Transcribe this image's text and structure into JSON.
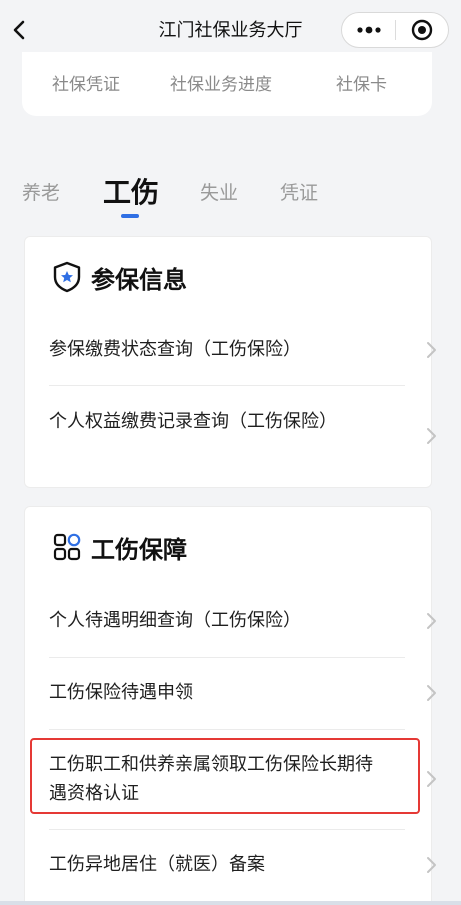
{
  "navbar": {
    "title": "江门社保业务大厅"
  },
  "quick_links": [
    "社保凭证",
    "社保业务进度",
    "社保卡"
  ],
  "tabs": [
    "养老",
    "工伤",
    "失业",
    "凭证"
  ],
  "active_tab": "工伤",
  "sections": [
    {
      "title": "参保信息",
      "icon": "shield-star-icon",
      "items": [
        "参保缴费状态查询（工伤保险）",
        "个人权益缴费记录查询（工伤保险）"
      ]
    },
    {
      "title": "工伤保障",
      "icon": "grid-apps-icon",
      "items": [
        "个人待遇明细查询（工伤保险）",
        "工伤保险待遇申领",
        "工伤职工和供养亲属领取工伤保险长期待遇资格认证",
        "工伤异地居住（就医）备案"
      ]
    }
  ],
  "colors": {
    "accent": "#2f6fe4",
    "highlight": "#e53935"
  }
}
